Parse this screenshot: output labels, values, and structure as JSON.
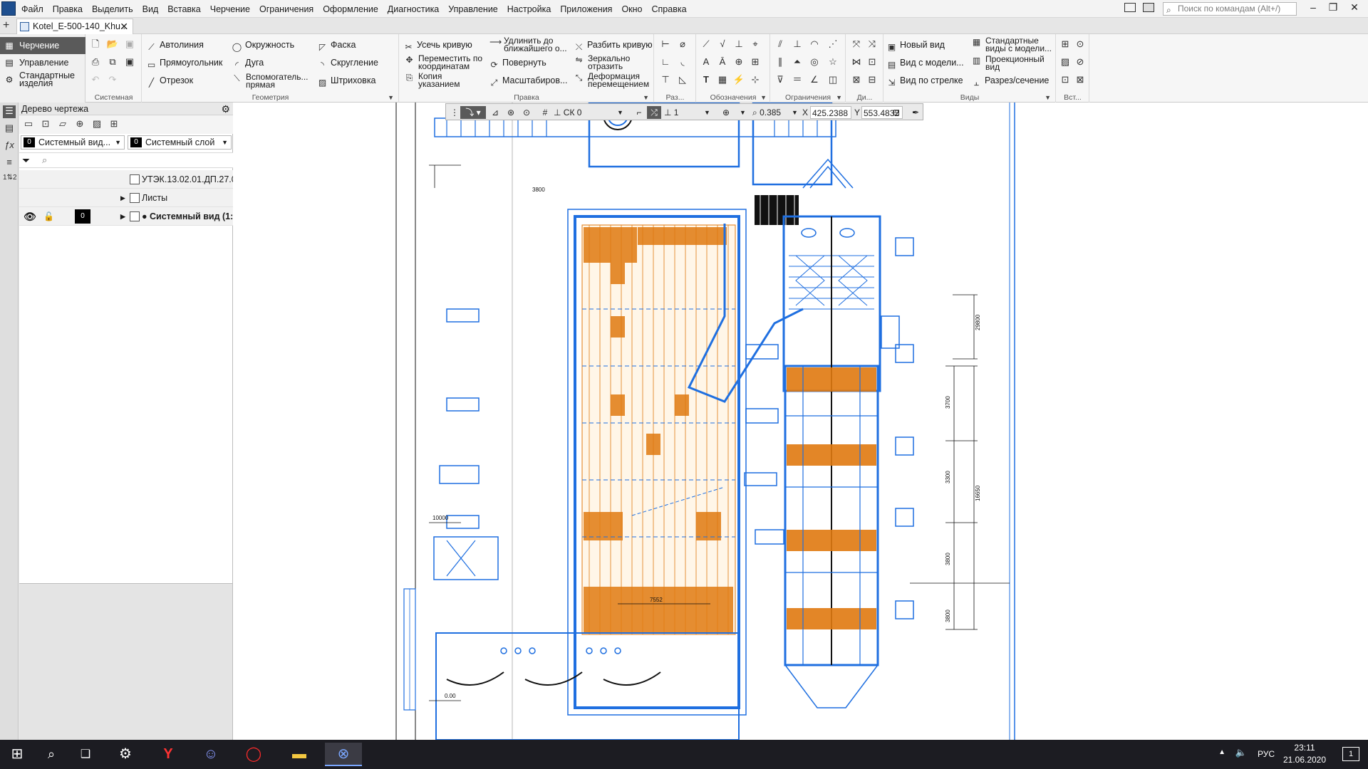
{
  "menubar": {
    "items": [
      "Файл",
      "Правка",
      "Выделить",
      "Вид",
      "Вставка",
      "Черчение",
      "Ограничения",
      "Оформление",
      "Диагностика",
      "Управление",
      "Настройка",
      "Приложения",
      "Окно",
      "Справка"
    ],
    "search_placeholder": "Поиск по командам (Alt+/)"
  },
  "tabs": {
    "document": "Kotel_E-500-140_Khu..."
  },
  "modes": {
    "items": [
      "Черчение",
      "Управление",
      "Стандартные изделия"
    ]
  },
  "ribbon": {
    "groups": {
      "system": "Системная",
      "geometry": "Геометрия",
      "edit": "Правка",
      "dims": "Раз...",
      "marks": "Обозначения",
      "constraints": "Ограничения",
      "di": "Ди...",
      "views": "Виды",
      "insert": "Вст..."
    },
    "geometry": {
      "autoline": "Автолиния",
      "circle": "Окружность",
      "chamfer": "Фаска",
      "rectangle": "Прямоугольник",
      "arc": "Дуга",
      "fillet": "Скругление",
      "segment": "Отрезок",
      "aux_line": "Вспомогатель... прямая",
      "hatch": "Штриховка"
    },
    "edit": {
      "trim": "Усечь кривую",
      "extend": "Удлинить до ближайшего о...",
      "split": "Разбить кривую",
      "move": "Переместить по координатам",
      "rotate": "Повернуть",
      "mirror": "Зеркально отразить",
      "copy": "Копия указанием",
      "scale": "Масштабиров...",
      "deform": "Деформация перемещением"
    },
    "views": {
      "new_view": "Новый вид",
      "std_views": "Стандартные виды с модели...",
      "model_view": "Вид с модели...",
      "proj_view": "Проекционный вид",
      "arrow_view": "Вид по стрелке",
      "section": "Разрез/сечение"
    }
  },
  "tree": {
    "title": "Дерево чертежа",
    "view_combo": {
      "num": "0",
      "label": "Системный вид..."
    },
    "layer_combo": {
      "num": "0",
      "label": "Системный слой"
    },
    "rows": {
      "doc": "УТЭК.13.02.01.ДП.27.00.0",
      "sheets": "Листы",
      "view": "● Системный вид (1:1"
    },
    "row_layer_num": "0"
  },
  "toolbar2": {
    "cs": "СК 0",
    "layer": "1",
    "zoom": "0.385",
    "x_label": "X",
    "x_value": "425.2388",
    "y_label": "Y",
    "y_value": "553.4832"
  },
  "drawing_labels": {
    "d1": "29800",
    "d2": "3700",
    "d3": "3300",
    "d4": "3800",
    "d5": "16650",
    "d6": "3800",
    "d7": "3800",
    "d8": "7552",
    "d9": "10000",
    "d10": "0.00"
  },
  "taskbar": {
    "lang": "РУС",
    "time": "23:11",
    "date": "21.06.2020",
    "notif": "1"
  },
  "colors": {
    "blue": "#1f6fe0",
    "orange": "#e07a10",
    "black": "#111111"
  }
}
